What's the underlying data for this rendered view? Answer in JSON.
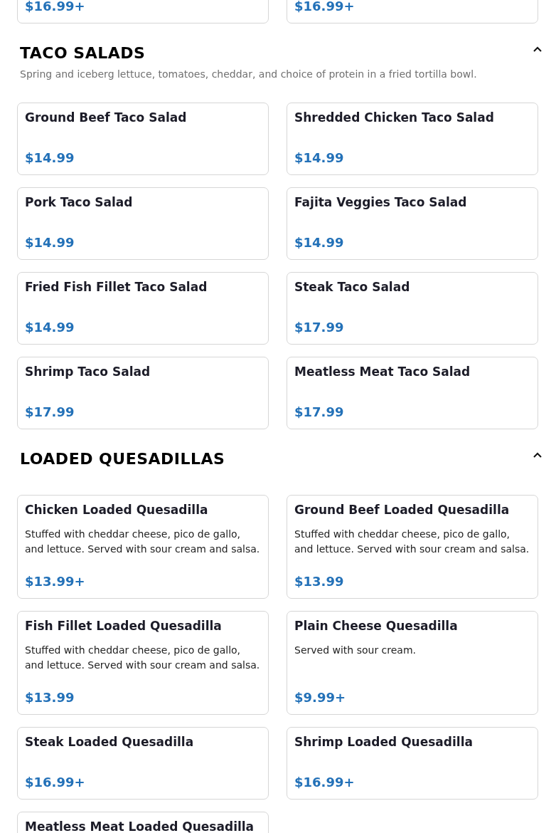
{
  "previous_section_items": [
    {
      "price": "$16.99+"
    },
    {
      "price": "$16.99+"
    }
  ],
  "sections": [
    {
      "title": "TACO SALADS",
      "description": "Spring and iceberg lettuce, tomatoes, cheddar, and choice of protein in a fried tortilla bowl.",
      "expanded": true,
      "items": [
        {
          "name": "Ground Beef Taco Salad",
          "price": "$14.99"
        },
        {
          "name": "Shredded Chicken Taco Salad",
          "price": "$14.99"
        },
        {
          "name": "Pork Taco Salad",
          "price": "$14.99"
        },
        {
          "name": "Fajita Veggies Taco Salad",
          "price": "$14.99"
        },
        {
          "name": "Fried Fish Fillet Taco Salad",
          "price": "$14.99"
        },
        {
          "name": "Steak Taco Salad",
          "price": "$17.99"
        },
        {
          "name": "Shrimp Taco Salad",
          "price": "$17.99"
        },
        {
          "name": "Meatless Meat Taco Salad",
          "price": "$17.99"
        }
      ]
    },
    {
      "title": "LOADED QUESADILLAS",
      "expanded": true,
      "items": [
        {
          "name": "Chicken Loaded Quesadilla",
          "description": "Stuffed with cheddar cheese, pico de gallo, and lettuce. Served with sour cream and salsa.",
          "price": "$13.99+"
        },
        {
          "name": "Ground Beef Loaded Quesadilla",
          "description": "Stuffed with cheddar cheese, pico de gallo, and lettuce. Served with sour cream and salsa.",
          "price": "$13.99"
        },
        {
          "name": "Fish Fillet Loaded Quesadilla",
          "description": "Stuffed with cheddar cheese, pico de gallo, and lettuce. Served with sour cream and salsa.",
          "price": "$13.99"
        },
        {
          "name": "Plain Cheese Quesadilla",
          "description": "Served with sour cream.",
          "price": "$9.99+"
        },
        {
          "name": "Steak Loaded Quesadilla",
          "price": "$16.99+"
        },
        {
          "name": "Shrimp Loaded Quesadilla",
          "price": "$16.99+"
        },
        {
          "name": "Meatless Meat Loaded Quesadilla"
        }
      ]
    }
  ]
}
